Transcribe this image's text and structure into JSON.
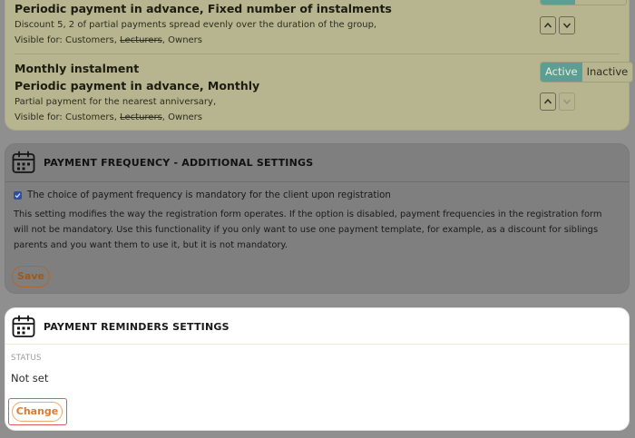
{
  "instalments": [
    {
      "title": "Periodic payment in advance, Fixed number of instalments",
      "description": "Discount 5, 2 of partial payments spread evenly over the duration of the group,",
      "visible_prefix": "Visible for: Customers, ",
      "visible_struck": "Lecturers",
      "visible_suffix": ", Owners"
    },
    {
      "name": "Monthly instalment",
      "title": "Periodic payment in advance, Monthly",
      "description": "Partial payment for the nearest anniversary,",
      "visible_prefix": "Visible for: Customers, ",
      "visible_struck": "Lecturers",
      "visible_suffix": ", Owners",
      "toggle_active": "Active",
      "toggle_inactive": "Inactive"
    }
  ],
  "frequency_settings": {
    "title": "PAYMENT FREQUENCY - ADDITIONAL SETTINGS",
    "checkbox_label": "The choice of payment frequency is mandatory for the client upon registration",
    "checkbox_checked": true,
    "note": "This setting modifies the way the registration form operates. If the option is disabled, payment frequencies in the registration form will not be mandatory. Use this functionality if you only want to use one payment template, for example, as a discount for siblings parents and you want them to use it, but it is not mandatory.",
    "save_label": "Save"
  },
  "reminders": {
    "title": "PAYMENT REMINDERS SETTINGS",
    "status_label": "STATUS",
    "status_value": "Not set",
    "change_label": "Change"
  },
  "colors": {
    "accent": "#e07a2a",
    "active_toggle": "#5c9e93",
    "highlight_frame": "#e25a5a"
  }
}
